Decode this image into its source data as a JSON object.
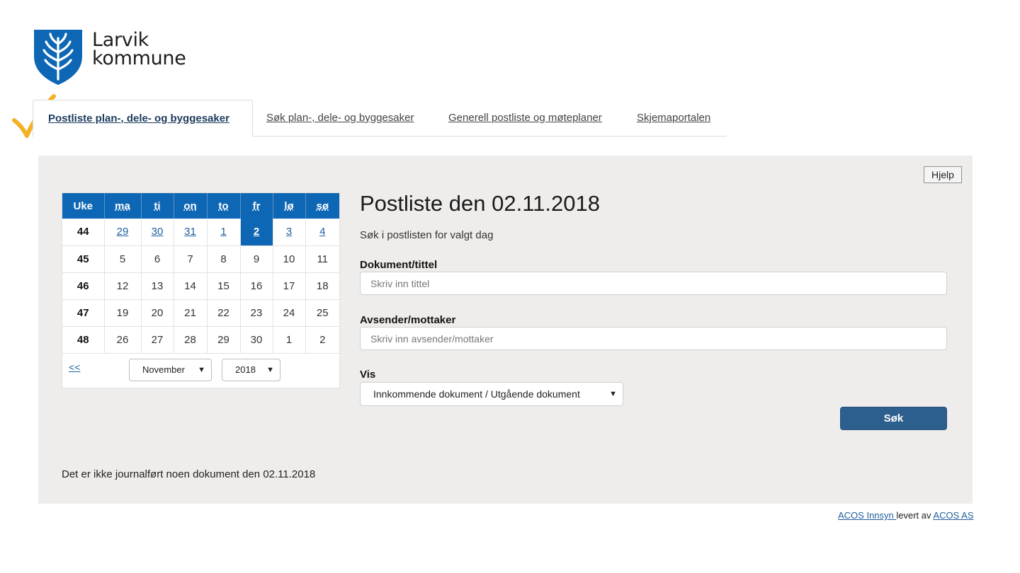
{
  "logo": {
    "line1": "Larvik",
    "line2": "kommune",
    "icon": "wheat-shield-icon"
  },
  "tabs": [
    {
      "label": "Postliste plan-, dele- og byggesaker",
      "active": true
    },
    {
      "label": "Søk plan-, dele- og byggesaker",
      "active": false
    },
    {
      "label": "Generell postliste og møteplaner",
      "active": false
    },
    {
      "label": "Skjemaportalen",
      "active": false
    }
  ],
  "help_label": "Hjelp",
  "calendar": {
    "headers": [
      "Uke",
      "ma",
      "ti",
      "on",
      "to",
      "fr",
      "lø",
      "sø"
    ],
    "weeks": [
      {
        "week": "44",
        "days": [
          "29",
          "30",
          "31",
          "1",
          "2",
          "3",
          "4"
        ]
      },
      {
        "week": "45",
        "days": [
          "5",
          "6",
          "7",
          "8",
          "9",
          "10",
          "11"
        ]
      },
      {
        "week": "46",
        "days": [
          "12",
          "13",
          "14",
          "15",
          "16",
          "17",
          "18"
        ]
      },
      {
        "week": "47",
        "days": [
          "19",
          "20",
          "21",
          "22",
          "23",
          "24",
          "25"
        ]
      },
      {
        "week": "48",
        "days": [
          "26",
          "27",
          "28",
          "29",
          "30",
          "1",
          "2"
        ]
      }
    ],
    "selected_day": "2",
    "prev_label": "<<",
    "month": "November",
    "year": "2018"
  },
  "main": {
    "title": "Postliste den 02.11.2018",
    "subtitle": "Søk i postlisten for valgt dag",
    "document_label": "Dokument/tittel",
    "document_placeholder": "Skriv inn tittel",
    "sender_label": "Avsender/mottaker",
    "sender_placeholder": "Skriv inn avsender/mottaker",
    "vis_label": "Vis",
    "vis_value": "Innkommende dokument / Utgående dokument",
    "search_label": "Søk",
    "no_docs": "Det er ikke journalført noen dokument den 02.11.2018"
  },
  "footer": {
    "link1": "ACOS Innsyn ",
    "text": "levert av ",
    "link2": "ACOS AS"
  },
  "colors": {
    "brand_blue": "#0e67b4",
    "button_blue": "#2d5f8e",
    "panel_bg": "#efedeb",
    "check": "#f3b225"
  }
}
